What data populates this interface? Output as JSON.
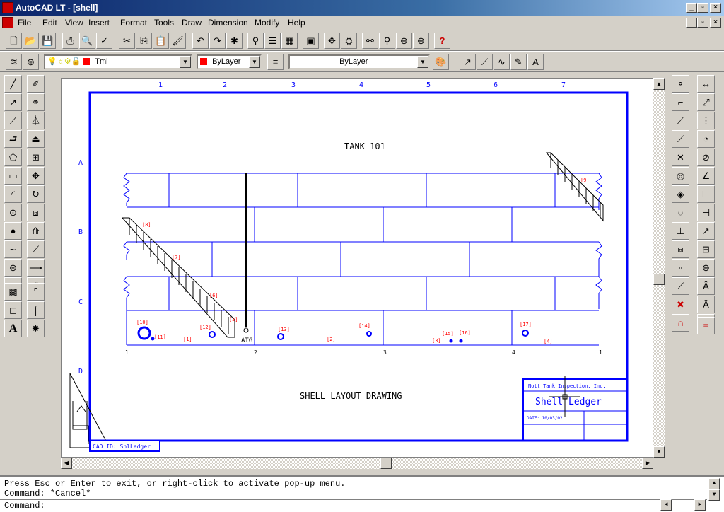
{
  "window": {
    "title": "AutoCAD LT - [shell]"
  },
  "menu": [
    "File",
    "Edit",
    "View",
    "Insert",
    "Format",
    "Tools",
    "Draw",
    "Dimension",
    "Modify",
    "Help"
  ],
  "layer_toolbar": {
    "layer": "Tml",
    "color": "ByLayer",
    "linetype": "ByLayer",
    "layer_color": "#ff0000"
  },
  "drawing": {
    "col_labels": [
      "1",
      "2",
      "3",
      "4",
      "5",
      "6",
      "7"
    ],
    "row_labels": [
      "A",
      "B",
      "C",
      "D"
    ],
    "tank_title": "TANK 101",
    "layout_title": "SHELL LAYOUT DRAWING",
    "bottom_labels": [
      "1",
      "2",
      "3",
      "4",
      "1"
    ],
    "atg": "ATG",
    "callouts": [
      "[1]",
      "[2]",
      "[3]",
      "[4]",
      "[5]",
      "[6]",
      "[7]",
      "[8]",
      "[9]",
      "[10]",
      "[11]",
      "[12]",
      "[13]",
      "[14]",
      "[15]",
      "[16]",
      "[17]"
    ],
    "title_block": {
      "company": "Nott Tank Inspection, Inc.",
      "name": "Shell Ledger",
      "date": "DATE: 10/03/02"
    },
    "cad_id": "CAD ID: ShlLedger",
    "line_color": "#0000ff",
    "callout_color": "#ff0000"
  },
  "command": {
    "lines": [
      "Press Esc or Enter to exit, or right-click to activate pop-up menu.",
      "Command: *Cancel*",
      "Command:"
    ]
  }
}
